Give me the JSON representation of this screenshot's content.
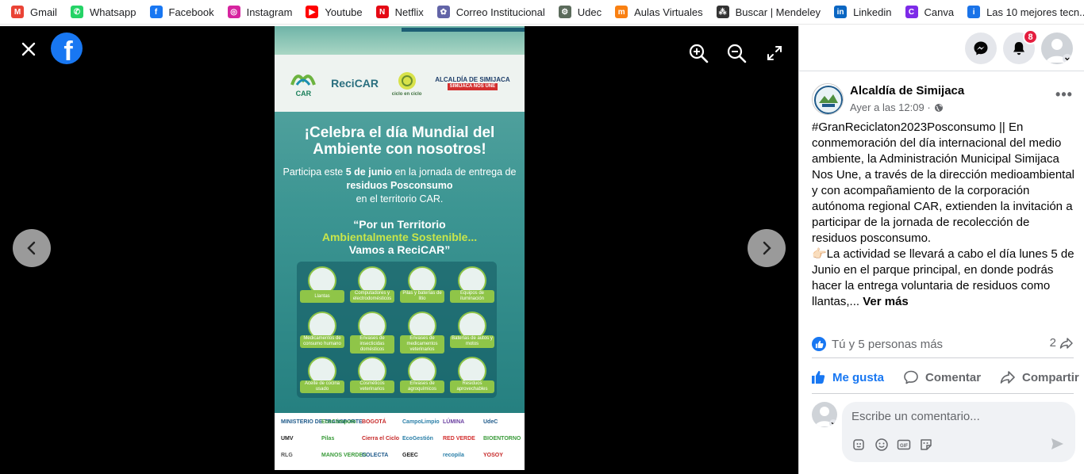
{
  "bookmarks": [
    {
      "label": "Gmail",
      "icon": "gmail-icon",
      "color": "#ea4335",
      "glyph": "M"
    },
    {
      "label": "Whatsapp",
      "icon": "whatsapp-icon",
      "color": "#25d366",
      "glyph": "✆"
    },
    {
      "label": "Facebook",
      "icon": "facebook-icon",
      "color": "#1877f2",
      "glyph": "f"
    },
    {
      "label": "Instagram",
      "icon": "instagram-icon",
      "color": "#d6249f",
      "glyph": "◎"
    },
    {
      "label": "Youtube",
      "icon": "youtube-icon",
      "color": "#ff0000",
      "glyph": "▶"
    },
    {
      "label": "Netflix",
      "icon": "netflix-icon",
      "color": "#e50914",
      "glyph": "N"
    },
    {
      "label": "Correo Institucional",
      "icon": "outlook-icon",
      "color": "#6264a7",
      "glyph": "✿"
    },
    {
      "label": "Udec",
      "icon": "udec-icon",
      "color": "#5b6b5b",
      "glyph": "⚙"
    },
    {
      "label": "Aulas Virtuales",
      "icon": "moodle-icon",
      "color": "#f98012",
      "glyph": "m"
    },
    {
      "label": "Buscar | Mendeley",
      "icon": "mendeley-icon",
      "color": "#333333",
      "glyph": "⁂"
    },
    {
      "label": "Linkedin",
      "icon": "linkedin-icon",
      "color": "#0a66c2",
      "glyph": "in"
    },
    {
      "label": "Canva",
      "icon": "canva-icon",
      "color": "#7d2ae8",
      "glyph": "C"
    },
    {
      "label": "Las 10 mejores tecn...",
      "icon": "info-icon",
      "color": "#1a73e8",
      "glyph": "i"
    }
  ],
  "poster": {
    "logos": [
      "CAR",
      "ReciCAR",
      "ciclo en ciclo",
      "ALCALDÍA DE SIMIJACA",
      "SIMIJACA NOS UNE"
    ],
    "headline": "¡Celebra el día Mundial del Ambiente con nosotros!",
    "sub_1": "Participa este",
    "sub_date": "5 de junio",
    "sub_2": "en la jornada de entrega de",
    "sub_bold": "residuos Posconsumo",
    "sub_3": "en el territorio CAR.",
    "slogan_1": "“Por un Territorio",
    "slogan_2": "Ambientalmente Sostenible...",
    "slogan_3": "Vamos a ReciCAR”",
    "items": [
      "Llantas",
      "Computadores y electrodomésticos",
      "Pilas y baterías de litio",
      "Equipos de iluminación",
      "Medicamentos de consumo humano",
      "Envases de insecticidas domésticos",
      "Envases de medicamentos veterinarios",
      "Baterías de autos y motos",
      "Aceite de cocina usado",
      "Cosméticos veterinarios",
      "Envases de agroquímicos",
      "Residuos aprovechables"
    ],
    "sponsors": [
      "MINISTERIO DE TRANSPORTE",
      "EcoCómputo",
      "BOGOTÁ",
      "CampoLimpio",
      "LÚMINA",
      "UdeC",
      "UMV",
      "Pilas",
      "Cierra el Ciclo",
      "EcoGestión",
      "RED VERDE",
      "BIOENTORNO",
      "RLG",
      "MANOS VERDES",
      "COLECTA",
      "GEEC",
      "recopila",
      "YOSOY"
    ]
  },
  "top_icons": {
    "notifications_count": "8"
  },
  "post": {
    "page_name": "Alcaldía de Simijaca",
    "time": "Ayer a las 12:09 ·",
    "hashtag": "#GranReciclaton2023Posconsumo",
    "body_1": " || En conmemoración del día internacional del medio ambiente, la Administración Municipal Simijaca Nos Une, a través de la dirección medioambiental y con acompañamiento de la corporación autónoma regional CAR, extienden la invitación a participar de la jornada de recolección de residuos posconsumo.",
    "body_2": "👉🏻La actividad se llevará a cabo el día lunes 5 de Junio en el parque principal, en donde podrás hacer la entrega voluntaria de residuos como llantas,... ",
    "see_more": "Ver más",
    "reactions_text": "Tú y 5 personas más",
    "shares_count": "2",
    "like_label": "Me gusta",
    "comment_label": "Comentar",
    "share_label": "Compartir",
    "comment_placeholder": "Escribe un comentario..."
  },
  "colors": {
    "facebook_blue": "#1877f2",
    "badge_red": "#e41e3f",
    "poster_teal": "#2f8c8b",
    "poster_green": "#8fc548"
  }
}
